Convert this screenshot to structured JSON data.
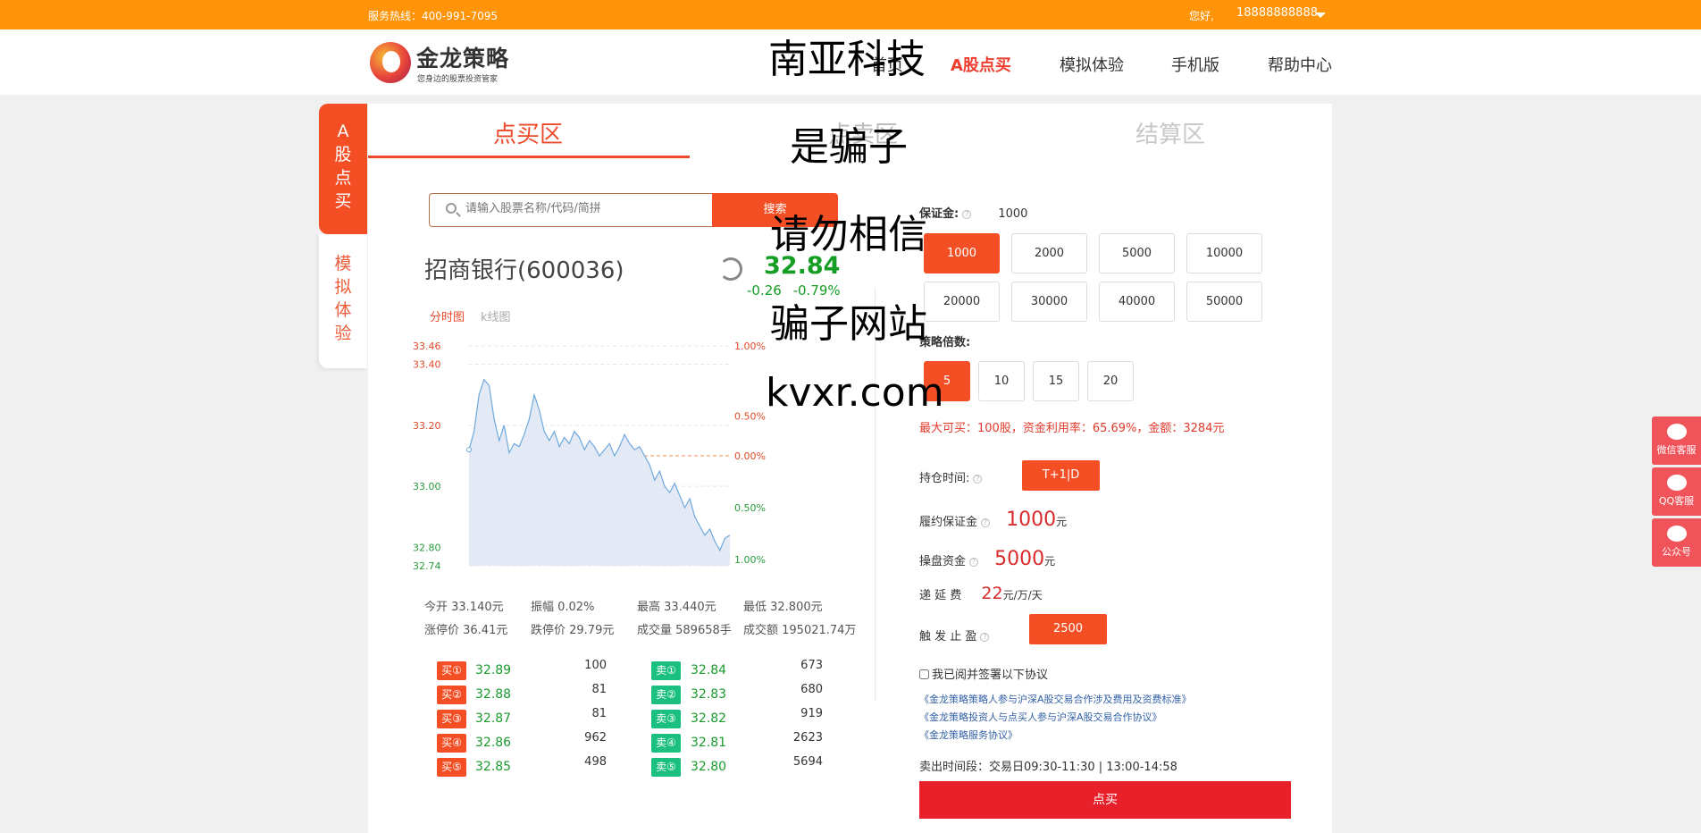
{
  "topbar": {
    "hotline": "服务热线：400-991-7095",
    "hello": "您好,",
    "phone": "18888888888"
  },
  "header": {
    "logo_title": "金龙策略",
    "logo_sub": "您身边的股票投资管家",
    "nav": [
      "首页",
      "A股点买",
      "模拟体验",
      "手机版",
      "帮助中心"
    ]
  },
  "watermark": [
    "南亚科技",
    "是骗子",
    "请勿相信",
    "骗子网站",
    "kvxr.com"
  ],
  "side_tabs": {
    "a": [
      "A",
      "股",
      "点",
      "买"
    ],
    "b": [
      "模",
      "拟",
      "体",
      "验"
    ]
  },
  "tabs": {
    "buy": "点买区",
    "mid": "点卖区",
    "settle": "结算区"
  },
  "search": {
    "placeholder": "请输入股票名称/代码/简拼",
    "button": "搜索"
  },
  "stock": {
    "name": "招商银行(600036)",
    "price": "32.84",
    "change": "-0.26",
    "change_pct": "-0.79%"
  },
  "chart_tabs": [
    "分时图",
    "k线图"
  ],
  "chart_data": {
    "type": "area",
    "y_left_ticks": [
      "33.46",
      "33.40",
      "33.20",
      "33.00",
      "32.80",
      "32.74"
    ],
    "y_right_ticks": [
      "1.00%",
      "0.50%",
      "0.00%",
      "0.50%",
      "1.00%"
    ],
    "ylim": [
      32.74,
      33.46
    ],
    "baseline": 33.1,
    "series": [
      {
        "values": [
          33.12,
          33.18,
          33.3,
          33.35,
          33.33,
          33.22,
          33.15,
          33.2,
          33.11,
          33.14,
          33.13,
          33.17,
          33.22,
          33.3,
          33.25,
          33.18,
          33.15,
          33.18,
          33.13,
          33.16,
          33.14,
          33.18,
          33.16,
          33.12,
          33.15,
          33.13,
          33.1,
          33.12,
          33.14,
          33.1,
          33.13,
          33.17,
          33.14,
          33.12,
          33.13,
          33.1,
          33.07,
          33.02,
          33.05,
          33.0,
          32.98,
          33.01,
          32.97,
          32.93,
          32.96,
          32.9,
          32.87,
          32.84,
          32.86,
          32.82,
          32.79,
          32.83,
          32.84
        ]
      }
    ]
  },
  "stats": {
    "row1": [
      "今开 33.140元",
      "振幅 0.02%",
      "最高 33.440元",
      "最低 32.800元"
    ],
    "row2": [
      "涨停价 36.41元",
      "跌停价 29.79元",
      "成交量 589658手",
      "成交额 195021.74万"
    ]
  },
  "orderbook": {
    "buy": [
      {
        "tag": "买①",
        "price": "32.89",
        "vol": "100"
      },
      {
        "tag": "买②",
        "price": "32.88",
        "vol": "81"
      },
      {
        "tag": "买③",
        "price": "32.87",
        "vol": "81"
      },
      {
        "tag": "买④",
        "price": "32.86",
        "vol": "962"
      },
      {
        "tag": "买⑤",
        "price": "32.85",
        "vol": "498"
      }
    ],
    "sell": [
      {
        "tag": "卖①",
        "price": "32.84",
        "vol": "673"
      },
      {
        "tag": "卖②",
        "price": "32.83",
        "vol": "680"
      },
      {
        "tag": "卖③",
        "price": "32.82",
        "vol": "919"
      },
      {
        "tag": "卖④",
        "price": "32.81",
        "vol": "2623"
      },
      {
        "tag": "卖⑤",
        "price": "32.80",
        "vol": "5694"
      }
    ]
  },
  "form": {
    "margin_label": "保证金:",
    "margin_value": "1000",
    "margin_options": [
      "1000",
      "2000",
      "5000",
      "10000",
      "20000",
      "30000",
      "40000",
      "50000"
    ],
    "multiple_label": "策略倍数:",
    "multiple_options": [
      "5",
      "10",
      "15",
      "20"
    ],
    "max_info": "最大可买：100股，资金利用率：65.69%，金额：3284元",
    "hold_label": "持仓时间:",
    "hold_value": "T+1|D",
    "perf_label": "履约保证金",
    "perf_value": "1000",
    "op_label": "操盘资金",
    "op_value": "5000",
    "unit_yuan": "元",
    "delay_label": "递 延 费",
    "delay_value": "22",
    "delay_unit": "元/万/天",
    "stop_label": "触 发 止 盈",
    "stop_value": "2500",
    "agree": "我已阅并签署以下协议",
    "links": [
      "《金龙策略策略人参与沪深A股交易合作涉及费用及资费标准》",
      "《金龙策略投资人与点买人参与沪深A股交易合作协议》",
      "《金龙策略服务协议》"
    ],
    "sell_time": "卖出时间段：交易日09:30-11:30 | 13:00-14:58",
    "submit": "点买"
  },
  "service": [
    "微信客服",
    "QQ客服",
    "公众号"
  ]
}
